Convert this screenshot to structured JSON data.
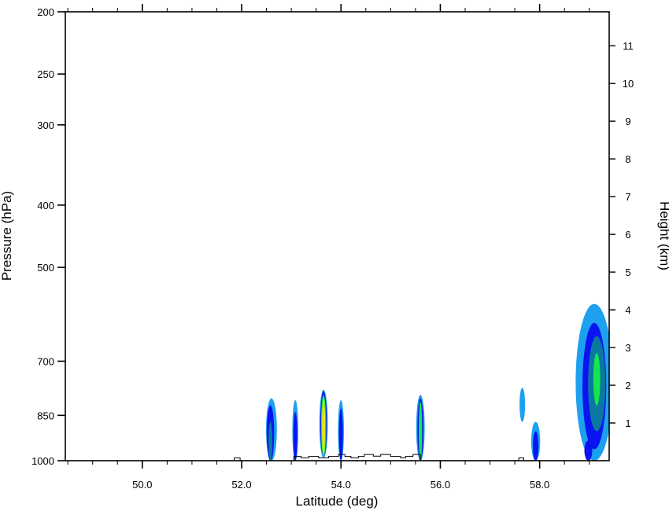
{
  "chart_data": {
    "type": "heatmap",
    "title": "",
    "xlabel": "Latitude (deg)",
    "ylabel": "Pressure (hPa)",
    "y2label": "Height (km)",
    "xlim": [
      48.45,
      59.4
    ],
    "ylim": [
      1000,
      200
    ],
    "y2lim": [
      0,
      11.9
    ],
    "yscale": "log",
    "x_ticks": [
      50.0,
      52.0,
      54.0,
      56.0,
      58.0
    ],
    "x_tick_labels": [
      "50.0",
      "52.0",
      "54.0",
      "56.0",
      "58.0"
    ],
    "y_ticks": [
      200,
      250,
      300,
      400,
      500,
      700,
      850,
      1000
    ],
    "y_tick_labels": [
      "200",
      "250",
      "300",
      "400",
      "500",
      "700",
      "850",
      "1000"
    ],
    "y2_ticks": [
      1,
      2,
      3,
      4,
      5,
      6,
      7,
      8,
      9,
      10,
      11
    ],
    "y2_tick_labels": [
      "1",
      "2",
      "3",
      "4",
      "5",
      "6",
      "7",
      "8",
      "9",
      "10",
      "11"
    ],
    "grid": false,
    "colors": [
      "#1ea0f0",
      "#0a14f0",
      "#0a78a0",
      "#14e650",
      "#e6e60a"
    ],
    "cells": [
      {
        "lat": 52.6,
        "p_top": 800,
        "p_bot": 1000,
        "w": 0.22,
        "level": 0
      },
      {
        "lat": 52.58,
        "p_top": 820,
        "p_bot": 1000,
        "w": 0.15,
        "level": 1
      },
      {
        "lat": 52.58,
        "p_top": 870,
        "p_bot": 1000,
        "w": 0.08,
        "level": 2
      },
      {
        "lat": 53.08,
        "p_top": 805,
        "p_bot": 1000,
        "w": 0.12,
        "level": 0
      },
      {
        "lat": 53.08,
        "p_top": 840,
        "p_bot": 1000,
        "w": 0.08,
        "level": 1
      },
      {
        "lat": 53.65,
        "p_top": 775,
        "p_bot": 990,
        "w": 0.17,
        "level": 0
      },
      {
        "lat": 53.65,
        "p_top": 780,
        "p_bot": 985,
        "w": 0.13,
        "level": 1
      },
      {
        "lat": 53.65,
        "p_top": 790,
        "p_bot": 985,
        "w": 0.1,
        "level": 3
      },
      {
        "lat": 53.65,
        "p_top": 800,
        "p_bot": 980,
        "w": 0.05,
        "level": 4
      },
      {
        "lat": 54.0,
        "p_top": 805,
        "p_bot": 1000,
        "w": 0.12,
        "level": 0
      },
      {
        "lat": 54.0,
        "p_top": 830,
        "p_bot": 1000,
        "w": 0.08,
        "level": 1
      },
      {
        "lat": 55.6,
        "p_top": 790,
        "p_bot": 1000,
        "w": 0.17,
        "level": 0
      },
      {
        "lat": 55.6,
        "p_top": 800,
        "p_bot": 1000,
        "w": 0.12,
        "level": 1
      },
      {
        "lat": 55.6,
        "p_top": 810,
        "p_bot": 1000,
        "w": 0.07,
        "level": 3
      },
      {
        "lat": 57.65,
        "p_top": 770,
        "p_bot": 870,
        "w": 0.11,
        "level": 0
      },
      {
        "lat": 57.92,
        "p_top": 870,
        "p_bot": 1000,
        "w": 0.18,
        "level": 0
      },
      {
        "lat": 57.92,
        "p_top": 900,
        "p_bot": 1000,
        "w": 0.11,
        "level": 1
      },
      {
        "lat": 59.1,
        "p_top": 570,
        "p_bot": 1000,
        "w": 0.75,
        "level": 0
      },
      {
        "lat": 59.1,
        "p_top": 610,
        "p_bot": 960,
        "w": 0.48,
        "level": 1
      },
      {
        "lat": 59.15,
        "p_top": 640,
        "p_bot": 900,
        "w": 0.35,
        "level": 2
      },
      {
        "lat": 59.15,
        "p_top": 680,
        "p_bot": 820,
        "w": 0.14,
        "level": 3
      },
      {
        "lat": 58.98,
        "p_top": 930,
        "p_bot": 1000,
        "w": 0.16,
        "level": 1
      }
    ],
    "terrain_steps": [
      [
        51.8,
        0
      ],
      [
        51.85,
        990
      ],
      [
        51.97,
        0
      ],
      [
        53.0,
        0
      ],
      [
        53.05,
        985
      ],
      [
        53.2,
        990
      ],
      [
        53.35,
        985
      ],
      [
        53.55,
        990
      ],
      [
        53.75,
        985
      ],
      [
        53.95,
        978
      ],
      [
        54.08,
        985
      ],
      [
        54.2,
        990
      ],
      [
        54.35,
        985
      ],
      [
        54.47,
        978
      ],
      [
        54.65,
        984
      ],
      [
        54.8,
        978
      ],
      [
        55.0,
        985
      ],
      [
        55.2,
        990
      ],
      [
        55.3,
        985
      ],
      [
        55.45,
        978
      ],
      [
        55.6,
        0
      ],
      [
        57.58,
        990
      ],
      [
        57.68,
        0
      ]
    ]
  }
}
